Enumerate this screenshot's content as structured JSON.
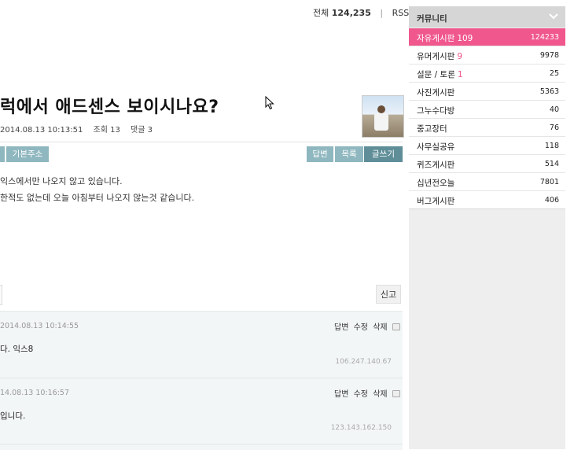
{
  "header": {
    "total_label": "전체",
    "total_count": "124,235",
    "separator": "|",
    "rss_label": "RSS"
  },
  "post": {
    "title": "럭에서 애드센스 보이시나요?",
    "date": "2014.08.13 10:13:51",
    "views": "조회 13",
    "comments": "댓글 3",
    "body_lines": [
      "익스에서만 나오지 않고 있습니다.",
      "한적도 없는데 오늘 아침부터 나오지 않는것 같습니다."
    ]
  },
  "toolbar": {
    "basic_addr_label": "기본주소",
    "reply_label": "답변",
    "list_label": "목록",
    "write_label": "글쓰기",
    "report_label": "신고"
  },
  "comments": [
    {
      "time": "2014.08.13 10:14:55",
      "actions": [
        "답변",
        "수정",
        "삭제"
      ],
      "text": "다. 익스8",
      "ip": "106.247.140.67"
    },
    {
      "time": "14.08.13 10:16:57",
      "actions": [
        "답변",
        "수정",
        "삭제"
      ],
      "text": "입니다.",
      "ip": "123.143.162.150"
    }
  ],
  "sidebar": {
    "title": "커뮤니티",
    "items": [
      {
        "name": "자유게시판",
        "new": "109",
        "count": "124233",
        "active": true
      },
      {
        "name": "유머게시판",
        "new": "9",
        "count": "9978"
      },
      {
        "name": "설문 / 토론",
        "new": "1",
        "count": "25"
      },
      {
        "name": "사진게시판",
        "new": "",
        "count": "5363"
      },
      {
        "name": "그누수다방",
        "new": "",
        "count": "40"
      },
      {
        "name": "중고장터",
        "new": "",
        "count": "76"
      },
      {
        "name": "사무실공유",
        "new": "",
        "count": "118"
      },
      {
        "name": "퀴즈게시판",
        "new": "",
        "count": "514"
      },
      {
        "name": "십년전오늘",
        "new": "",
        "count": "7801"
      },
      {
        "name": "버그게시판",
        "new": "",
        "count": "406"
      }
    ]
  },
  "colors": {
    "active_item": "#f0578d",
    "new_count": "#ee5588",
    "button": "#8fb7bf",
    "button_dark": "#5f8e98"
  },
  "icons": [
    "chevron-down-icon",
    "lock-icon",
    "cursor-icon"
  ]
}
